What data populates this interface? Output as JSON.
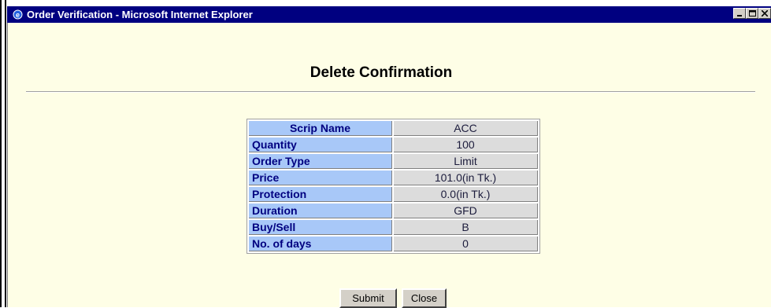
{
  "window": {
    "title": "Order Verification - Microsoft Internet Explorer",
    "controls": [
      "minimize",
      "maximize",
      "close"
    ]
  },
  "page": {
    "heading": "Delete Confirmation"
  },
  "details": {
    "rows": [
      {
        "label": "Scrip Name",
        "value": "ACC"
      },
      {
        "label": "Quantity",
        "value": "100"
      },
      {
        "label": "Order Type",
        "value": "Limit"
      },
      {
        "label": "Price",
        "value": "101.0(in Tk.)"
      },
      {
        "label": "Protection",
        "value": "0.0(in Tk.)"
      },
      {
        "label": "Duration",
        "value": "GFD"
      },
      {
        "label": "Buy/Sell",
        "value": "B"
      },
      {
        "label": "No. of days",
        "value": "0"
      }
    ]
  },
  "buttons": {
    "submit": "Submit",
    "close": "Close"
  },
  "colors": {
    "titlebar": "#000080",
    "background": "#fefee6",
    "label_cell": "#a8c8f8",
    "value_cell": "#dcdcdc"
  }
}
